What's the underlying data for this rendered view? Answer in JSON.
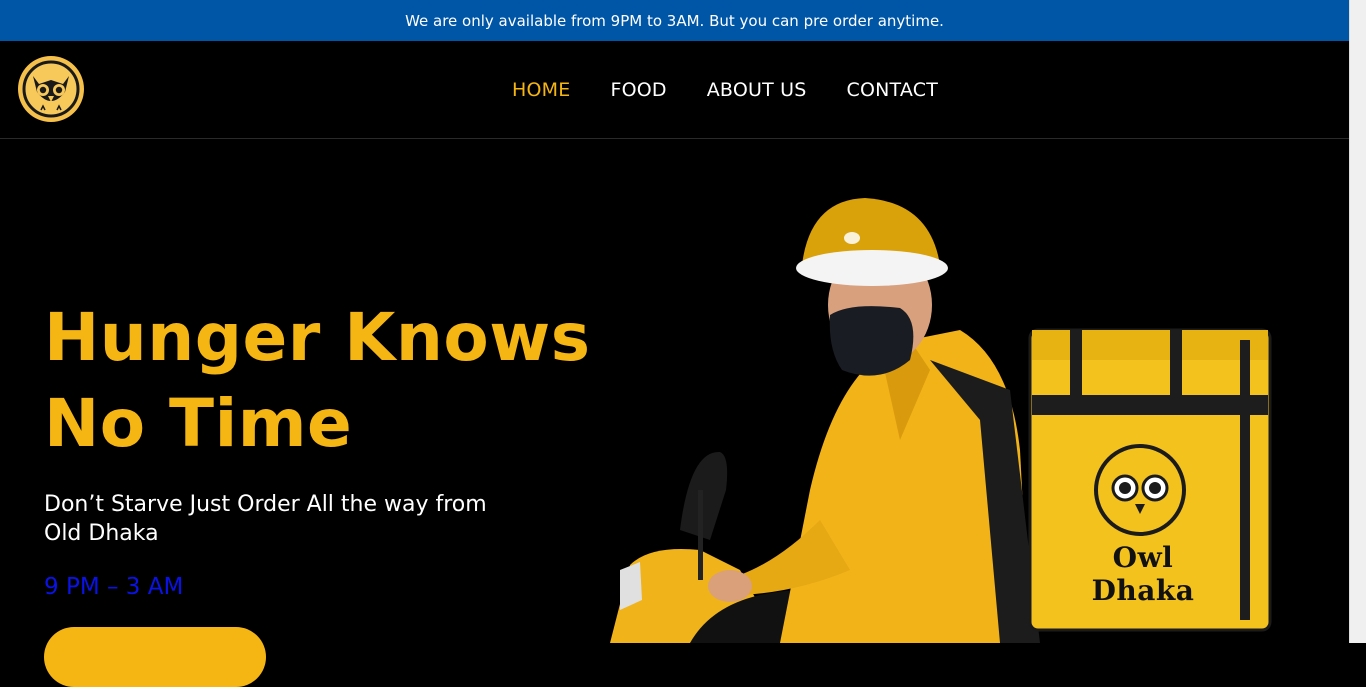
{
  "announcement": {
    "text": "We are only available from 9PM to 3AM. But you can pre order anytime."
  },
  "navbar": {
    "logo_icon": "owl-icon",
    "links": [
      {
        "label": "HOME",
        "active": true
      },
      {
        "label": "FOOD",
        "active": false
      },
      {
        "label": "ABOUT US",
        "active": false
      },
      {
        "label": "CONTACT",
        "active": false
      }
    ]
  },
  "hero": {
    "title_line1": "Hunger Knows",
    "title_line2": "No Time",
    "subtitle": "Don’t Starve Just Order All the way from Old Dhaka",
    "hours": "9 PM – 3 AM",
    "bag_brand": "Owl Dhaka"
  },
  "colors": {
    "accent": "#f5b614",
    "announcement_bg": "#0056a6",
    "hours_text": "#0a12e6",
    "background": "#000000"
  }
}
